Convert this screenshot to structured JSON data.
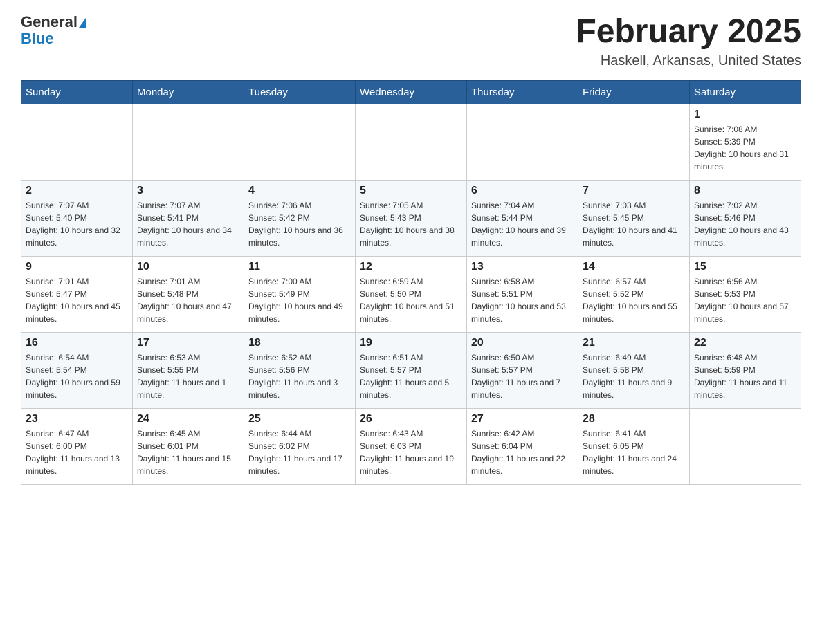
{
  "header": {
    "logo_general": "General",
    "logo_blue": "Blue",
    "title": "February 2025",
    "subtitle": "Haskell, Arkansas, United States"
  },
  "weekdays": [
    "Sunday",
    "Monday",
    "Tuesday",
    "Wednesday",
    "Thursday",
    "Friday",
    "Saturday"
  ],
  "weeks": [
    [
      {
        "day": "",
        "info": ""
      },
      {
        "day": "",
        "info": ""
      },
      {
        "day": "",
        "info": ""
      },
      {
        "day": "",
        "info": ""
      },
      {
        "day": "",
        "info": ""
      },
      {
        "day": "",
        "info": ""
      },
      {
        "day": "1",
        "info": "Sunrise: 7:08 AM\nSunset: 5:39 PM\nDaylight: 10 hours and 31 minutes."
      }
    ],
    [
      {
        "day": "2",
        "info": "Sunrise: 7:07 AM\nSunset: 5:40 PM\nDaylight: 10 hours and 32 minutes."
      },
      {
        "day": "3",
        "info": "Sunrise: 7:07 AM\nSunset: 5:41 PM\nDaylight: 10 hours and 34 minutes."
      },
      {
        "day": "4",
        "info": "Sunrise: 7:06 AM\nSunset: 5:42 PM\nDaylight: 10 hours and 36 minutes."
      },
      {
        "day": "5",
        "info": "Sunrise: 7:05 AM\nSunset: 5:43 PM\nDaylight: 10 hours and 38 minutes."
      },
      {
        "day": "6",
        "info": "Sunrise: 7:04 AM\nSunset: 5:44 PM\nDaylight: 10 hours and 39 minutes."
      },
      {
        "day": "7",
        "info": "Sunrise: 7:03 AM\nSunset: 5:45 PM\nDaylight: 10 hours and 41 minutes."
      },
      {
        "day": "8",
        "info": "Sunrise: 7:02 AM\nSunset: 5:46 PM\nDaylight: 10 hours and 43 minutes."
      }
    ],
    [
      {
        "day": "9",
        "info": "Sunrise: 7:01 AM\nSunset: 5:47 PM\nDaylight: 10 hours and 45 minutes."
      },
      {
        "day": "10",
        "info": "Sunrise: 7:01 AM\nSunset: 5:48 PM\nDaylight: 10 hours and 47 minutes."
      },
      {
        "day": "11",
        "info": "Sunrise: 7:00 AM\nSunset: 5:49 PM\nDaylight: 10 hours and 49 minutes."
      },
      {
        "day": "12",
        "info": "Sunrise: 6:59 AM\nSunset: 5:50 PM\nDaylight: 10 hours and 51 minutes."
      },
      {
        "day": "13",
        "info": "Sunrise: 6:58 AM\nSunset: 5:51 PM\nDaylight: 10 hours and 53 minutes."
      },
      {
        "day": "14",
        "info": "Sunrise: 6:57 AM\nSunset: 5:52 PM\nDaylight: 10 hours and 55 minutes."
      },
      {
        "day": "15",
        "info": "Sunrise: 6:56 AM\nSunset: 5:53 PM\nDaylight: 10 hours and 57 minutes."
      }
    ],
    [
      {
        "day": "16",
        "info": "Sunrise: 6:54 AM\nSunset: 5:54 PM\nDaylight: 10 hours and 59 minutes."
      },
      {
        "day": "17",
        "info": "Sunrise: 6:53 AM\nSunset: 5:55 PM\nDaylight: 11 hours and 1 minute."
      },
      {
        "day": "18",
        "info": "Sunrise: 6:52 AM\nSunset: 5:56 PM\nDaylight: 11 hours and 3 minutes."
      },
      {
        "day": "19",
        "info": "Sunrise: 6:51 AM\nSunset: 5:57 PM\nDaylight: 11 hours and 5 minutes."
      },
      {
        "day": "20",
        "info": "Sunrise: 6:50 AM\nSunset: 5:57 PM\nDaylight: 11 hours and 7 minutes."
      },
      {
        "day": "21",
        "info": "Sunrise: 6:49 AM\nSunset: 5:58 PM\nDaylight: 11 hours and 9 minutes."
      },
      {
        "day": "22",
        "info": "Sunrise: 6:48 AM\nSunset: 5:59 PM\nDaylight: 11 hours and 11 minutes."
      }
    ],
    [
      {
        "day": "23",
        "info": "Sunrise: 6:47 AM\nSunset: 6:00 PM\nDaylight: 11 hours and 13 minutes."
      },
      {
        "day": "24",
        "info": "Sunrise: 6:45 AM\nSunset: 6:01 PM\nDaylight: 11 hours and 15 minutes."
      },
      {
        "day": "25",
        "info": "Sunrise: 6:44 AM\nSunset: 6:02 PM\nDaylight: 11 hours and 17 minutes."
      },
      {
        "day": "26",
        "info": "Sunrise: 6:43 AM\nSunset: 6:03 PM\nDaylight: 11 hours and 19 minutes."
      },
      {
        "day": "27",
        "info": "Sunrise: 6:42 AM\nSunset: 6:04 PM\nDaylight: 11 hours and 22 minutes."
      },
      {
        "day": "28",
        "info": "Sunrise: 6:41 AM\nSunset: 6:05 PM\nDaylight: 11 hours and 24 minutes."
      },
      {
        "day": "",
        "info": ""
      }
    ]
  ]
}
